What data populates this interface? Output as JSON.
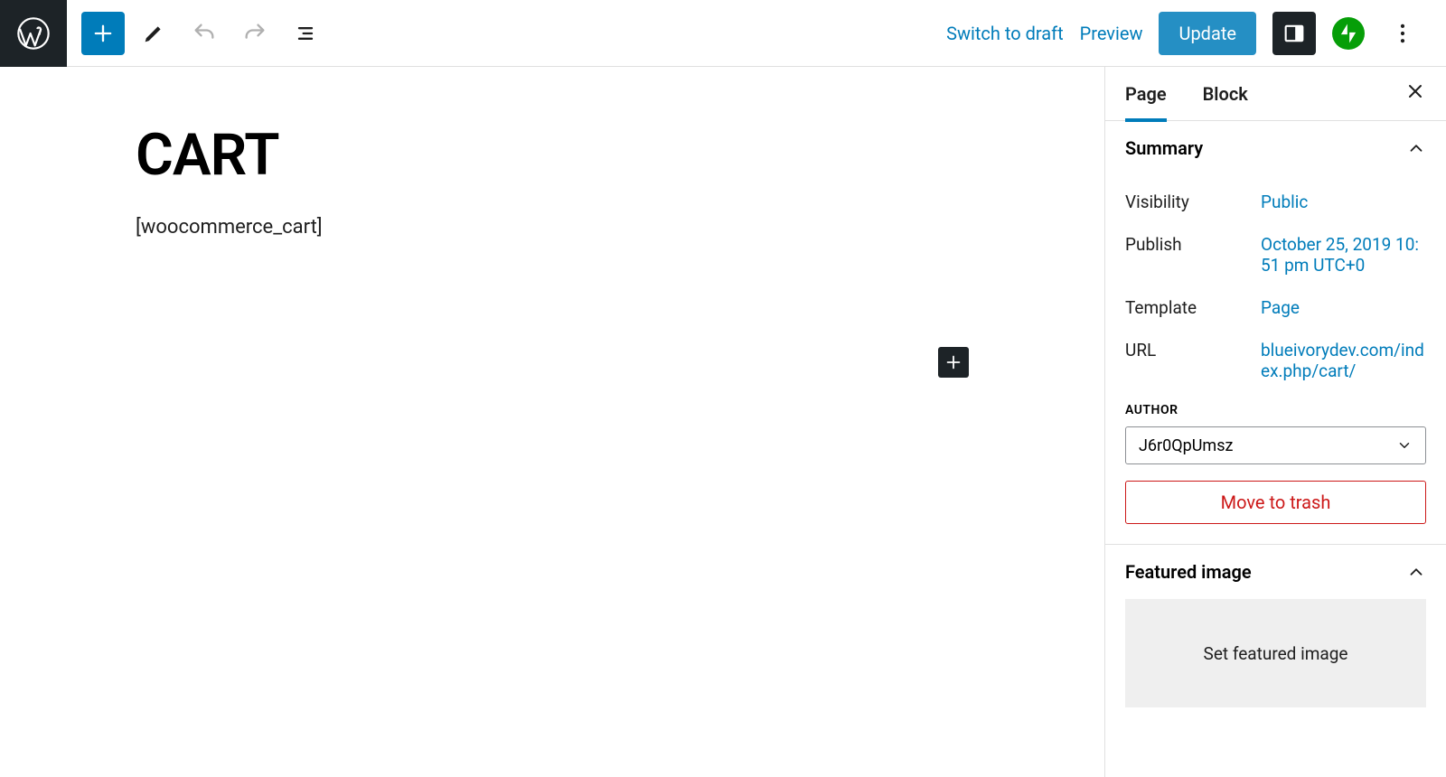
{
  "toolbar": {
    "switch_to_draft": "Switch to draft",
    "preview": "Preview",
    "update": "Update"
  },
  "editor": {
    "title": "CART",
    "content": "[woocommerce_cart]"
  },
  "sidebar": {
    "tabs": {
      "page": "Page",
      "block": "Block"
    },
    "summary": {
      "heading": "Summary",
      "visibility": {
        "label": "Visibility",
        "value": "Public"
      },
      "publish": {
        "label": "Publish",
        "value": "October 25, 2019 10:51 pm UTC+0"
      },
      "template": {
        "label": "Template",
        "value": "Page"
      },
      "url": {
        "label": "URL",
        "value": "blueivorydev.com/index.php/cart/"
      },
      "author": {
        "label": "AUTHOR",
        "value": "J6r0QpUmsz"
      },
      "trash": "Move to trash"
    },
    "featured": {
      "heading": "Featured image",
      "placeholder": "Set featured image"
    }
  }
}
